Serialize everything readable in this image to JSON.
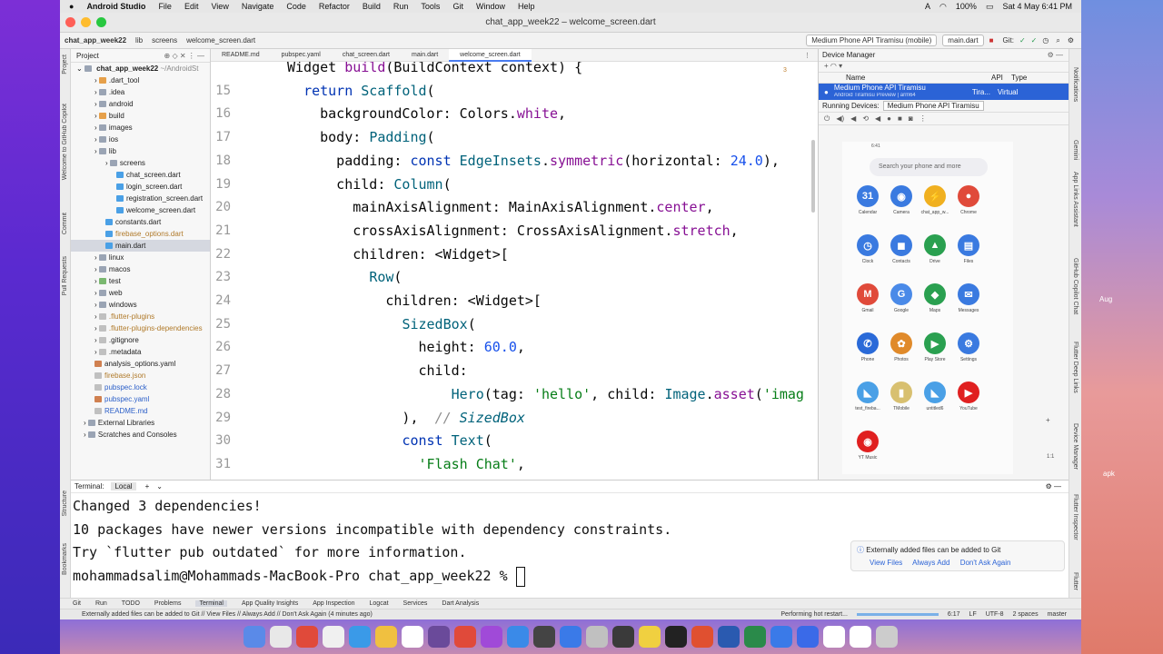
{
  "menubar": {
    "app": "Android Studio",
    "items": [
      "File",
      "Edit",
      "View",
      "Navigate",
      "Code",
      "Refactor",
      "Build",
      "Run",
      "Tools",
      "Git",
      "Window",
      "Help"
    ],
    "battery": "100%",
    "datetime": "Sat 4 May  6:41 PM",
    "input": "A"
  },
  "window": {
    "title": "chat_app_week22 – welcome_screen.dart"
  },
  "toolbar": {
    "breadcrumb": [
      "chat_app_week22",
      "lib",
      "screens",
      "welcome_screen.dart"
    ],
    "device": "Medium Phone API Tiramisu (mobile)",
    "config": "main.dart",
    "git_label": "Git:"
  },
  "left_stripe": [
    "Project",
    "Welcome to GitHub Copilot",
    "Commit",
    "Pull Requests",
    "Structure",
    "Bookmarks"
  ],
  "project": {
    "title": "Project",
    "root": "chat_app_week22",
    "root_path": "~/AndroidSt",
    "tree": [
      {
        "label": ".dart_tool",
        "depth": 1,
        "color": "#e6a04a"
      },
      {
        "label": ".idea",
        "depth": 1,
        "color": "#9aa4b4"
      },
      {
        "label": "android",
        "depth": 1,
        "color": "#9aa4b4"
      },
      {
        "label": "build",
        "depth": 1,
        "color": "#e6a04a"
      },
      {
        "label": "images",
        "depth": 1,
        "color": "#9aa4b4"
      },
      {
        "label": "ios",
        "depth": 1,
        "color": "#9aa4b4"
      },
      {
        "label": "lib",
        "depth": 1,
        "color": "#9aa4b4"
      },
      {
        "label": "screens",
        "depth": 2,
        "color": "#9aa4b4"
      },
      {
        "label": "chat_screen.dart",
        "depth": 3,
        "color": "#4aa0e6"
      },
      {
        "label": "login_screen.dart",
        "depth": 3,
        "color": "#4aa0e6"
      },
      {
        "label": "registration_screen.dart",
        "depth": 3,
        "color": "#4aa0e6"
      },
      {
        "label": "welcome_screen.dart",
        "depth": 3,
        "color": "#4aa0e6"
      },
      {
        "label": "constants.dart",
        "depth": 2,
        "color": "#4aa0e6"
      },
      {
        "label": "firebase_options.dart",
        "depth": 2,
        "color": "#4aa0e6",
        "muted": true
      },
      {
        "label": "main.dart",
        "depth": 2,
        "color": "#4aa0e6",
        "selected": true
      },
      {
        "label": "linux",
        "depth": 1,
        "color": "#9aa4b4"
      },
      {
        "label": "macos",
        "depth": 1,
        "color": "#9aa4b4"
      },
      {
        "label": "test",
        "depth": 1,
        "color": "#7ab870"
      },
      {
        "label": "web",
        "depth": 1,
        "color": "#9aa4b4"
      },
      {
        "label": "windows",
        "depth": 1,
        "color": "#9aa4b4"
      },
      {
        "label": ".flutter-plugins",
        "depth": 1,
        "color": "#c0c0c0",
        "muted": true
      },
      {
        "label": ".flutter-plugins-dependencies",
        "depth": 1,
        "color": "#c0c0c0",
        "muted": true
      },
      {
        "label": ".gitignore",
        "depth": 1,
        "color": "#c0c0c0"
      },
      {
        "label": ".metadata",
        "depth": 1,
        "color": "#c0c0c0"
      },
      {
        "label": "analysis_options.yaml",
        "depth": 1,
        "color": "#d08050"
      },
      {
        "label": "firebase.json",
        "depth": 1,
        "color": "#c0c0c0",
        "muted": true
      },
      {
        "label": "pubspec.lock",
        "depth": 1,
        "color": "#c0c0c0",
        "link": true
      },
      {
        "label": "pubspec.yaml",
        "depth": 1,
        "color": "#d08050",
        "link": true
      },
      {
        "label": "README.md",
        "depth": 1,
        "color": "#c0c0c0",
        "link": true
      },
      {
        "label": "External Libraries",
        "depth": 0,
        "color": "#9aa4b4"
      },
      {
        "label": "Scratches and Consoles",
        "depth": 0,
        "color": "#9aa4b4"
      }
    ]
  },
  "editor": {
    "tabs": [
      "README.md",
      "pubspec.yaml",
      "chat_screen.dart",
      "main.dart",
      "welcome_screen.dart"
    ],
    "active_tab": "welcome_screen.dart",
    "hint_count": "3",
    "lines": [
      {
        "n": "",
        "code": "Widget build(BuildContext context) {"
      },
      {
        "n": "15",
        "code": "  return Scaffold("
      },
      {
        "n": "16",
        "code": "    backgroundColor: Colors.white,"
      },
      {
        "n": "17",
        "code": "    body: Padding("
      },
      {
        "n": "18",
        "code": "      padding: const EdgeInsets.symmetric(horizontal: 24.0),"
      },
      {
        "n": "19",
        "code": "      child: Column("
      },
      {
        "n": "20",
        "code": "        mainAxisAlignment: MainAxisAlignment.center,"
      },
      {
        "n": "21",
        "code": "        crossAxisAlignment: CrossAxisAlignment.stretch,"
      },
      {
        "n": "22",
        "code": "        children: <Widget>["
      },
      {
        "n": "23",
        "code": "          Row("
      },
      {
        "n": "24",
        "code": "            children: <Widget>["
      },
      {
        "n": "25",
        "code": "              SizedBox("
      },
      {
        "n": "26",
        "code": "                height: 60.0,"
      },
      {
        "n": "27",
        "code": "                child:"
      },
      {
        "n": "28",
        "code": "                    Hero(tag: 'hello', child: Image.asset('imag"
      },
      {
        "n": "29",
        "code": "              ),  // SizedBox"
      },
      {
        "n": "30",
        "code": "              const Text("
      },
      {
        "n": "31",
        "code": "                'Flash Chat',"
      }
    ]
  },
  "device_manager": {
    "title": "Device Manager",
    "columns": [
      "Name",
      "API",
      "Type"
    ],
    "device_name": "Medium Phone API Tiramisu",
    "device_sub": "Android Tiramisu Preview | arm64",
    "device_api": "Tira...",
    "device_type": "Virtual",
    "running_label": "Running Devices:",
    "running_tab": "Medium Phone API Tiramisu",
    "phone": {
      "time": "6:41",
      "search": "Search your phone and more",
      "apps": [
        {
          "label": "Calendar",
          "icon": "31",
          "color": "#3a7ae0"
        },
        {
          "label": "Camera",
          "icon": "◉",
          "color": "#3a7ae0"
        },
        {
          "label": "chat_app_w...",
          "icon": "⚡",
          "color": "#f0b020"
        },
        {
          "label": "Chrome",
          "icon": "●",
          "color": "#e04a3a"
        },
        {
          "label": "Clock",
          "icon": "◷",
          "color": "#3a7ae0"
        },
        {
          "label": "Contacts",
          "icon": "◼",
          "color": "#3a7ae0"
        },
        {
          "label": "Drive",
          "icon": "▲",
          "color": "#2aa050"
        },
        {
          "label": "Files",
          "icon": "▤",
          "color": "#3a7ae0"
        },
        {
          "label": "Gmail",
          "icon": "M",
          "color": "#e04a3a"
        },
        {
          "label": "Google",
          "icon": "G",
          "color": "#4a8ae8"
        },
        {
          "label": "Maps",
          "icon": "◆",
          "color": "#2aa050"
        },
        {
          "label": "Messages",
          "icon": "✉",
          "color": "#3a7ae0"
        },
        {
          "label": "Phone",
          "icon": "✆",
          "color": "#2a6ad8"
        },
        {
          "label": "Photos",
          "icon": "✿",
          "color": "#e08a2a"
        },
        {
          "label": "Play Store",
          "icon": "▶",
          "color": "#2aa050"
        },
        {
          "label": "Settings",
          "icon": "⚙",
          "color": "#3a7ae0"
        },
        {
          "label": "test_fireba...",
          "icon": "◣",
          "color": "#4aa0e6"
        },
        {
          "label": "TMobile",
          "icon": "▮",
          "color": "#d8c070"
        },
        {
          "label": "untitled6",
          "icon": "◣",
          "color": "#4aa0e6"
        },
        {
          "label": "YouTube",
          "icon": "▶",
          "color": "#e02020"
        },
        {
          "label": "YT Music",
          "icon": "◉",
          "color": "#e02020"
        }
      ]
    },
    "zoom_ratio": "1:1"
  },
  "right_stripe": [
    "Notifications",
    "Gemini",
    "App Links Assistant",
    "GitHub Copilot Chat",
    "Flutter Deep Links",
    "Device Manager",
    "Flutter Inspector",
    "Flutter"
  ],
  "terminal": {
    "label": "Terminal:",
    "tab": "Local",
    "lines": [
      "Changed 3 dependencies!",
      "10 packages have newer versions incompatible with dependency constraints.",
      "Try `flutter pub outdated` for more information.",
      "mohammadsalim@Mohammads-MacBook-Pro chat_app_week22 % "
    ]
  },
  "notification": {
    "text": "Externally added files can be added to Git",
    "actions": [
      "View Files",
      "Always Add",
      "Don't Ask Again"
    ]
  },
  "tool_windows": [
    "Git",
    "Run",
    "TODO",
    "Problems",
    "Terminal",
    "App Quality Insights",
    "App Inspection",
    "Logcat",
    "Services",
    "Dart Analysis"
  ],
  "status": {
    "message": "Externally added files can be added to Git // View Files // Always Add // Don't Ask Again (4 minutes ago)",
    "task": "Performing hot restart...",
    "position": "6:17",
    "line_sep": "LF",
    "encoding": "UTF-8",
    "indent": "2 spaces",
    "branch": "master"
  },
  "desktop": {
    "label_aug": "Aug",
    "label_apk": "apk"
  }
}
